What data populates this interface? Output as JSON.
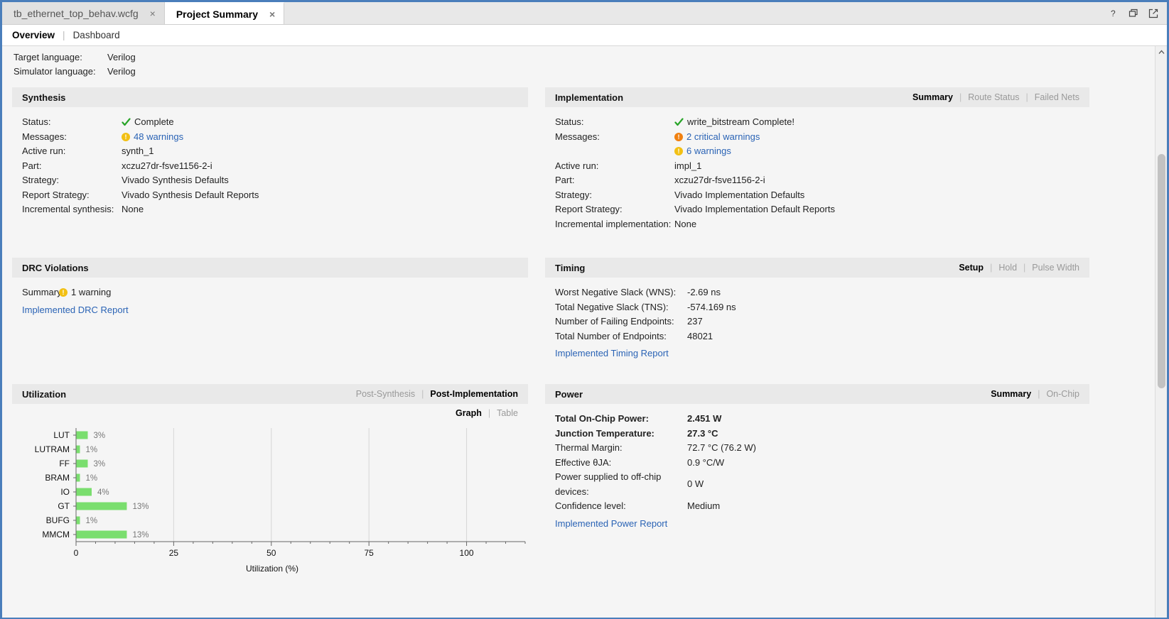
{
  "window": {
    "tabs": [
      {
        "label": "tb_ethernet_top_behav.wcfg",
        "active": false,
        "close": "×"
      },
      {
        "label": "Project Summary",
        "active": true,
        "close": "×"
      }
    ],
    "controls": [
      {
        "name": "help-icon",
        "glyph": "?"
      },
      {
        "name": "restore-icon",
        "glyph": "❐"
      },
      {
        "name": "detach-icon",
        "glyph": "↗"
      }
    ]
  },
  "subnav": {
    "overview": "Overview",
    "separator": "|",
    "dashboard": "Dashboard"
  },
  "top_info": {
    "rows": [
      {
        "key": "Target language:",
        "value": "Verilog",
        "link": true
      },
      {
        "key": "Simulator language:",
        "value": "Verilog",
        "link": true
      }
    ]
  },
  "synthesis": {
    "title": "Synthesis",
    "rows": [
      {
        "key": "Status:",
        "value": "Complete",
        "icon": "check",
        "link": false
      },
      {
        "key": "Messages:",
        "value": "48 warnings",
        "icon": "warn",
        "link": true
      },
      {
        "key": "Active run:",
        "value": "synth_1",
        "link": true
      },
      {
        "key": "Part:",
        "value": "xczu27dr-fsve1156-2-i",
        "link": false
      },
      {
        "key": "Strategy:",
        "value": "Vivado Synthesis Defaults",
        "link": true
      },
      {
        "key": "Report Strategy:",
        "value": "Vivado Synthesis Default Reports",
        "link": true
      },
      {
        "key": "Incremental synthesis:",
        "value": "None",
        "link": true
      }
    ]
  },
  "implementation": {
    "title": "Implementation",
    "head_tabs": [
      {
        "label": "Summary",
        "active": true
      },
      {
        "label": "Route Status",
        "active": false
      },
      {
        "label": "Failed Nets",
        "active": false
      }
    ],
    "rows": [
      {
        "key": "Status:",
        "value": "write_bitstream Complete!",
        "icon": "check",
        "link": false
      },
      {
        "key": "Messages:",
        "value": "2 critical warnings",
        "icon": "warn-crit",
        "link": true
      },
      {
        "key": "",
        "value": "6 warnings",
        "icon": "warn",
        "link": true
      },
      {
        "key": "Active run:",
        "value": "impl_1",
        "link": true
      },
      {
        "key": "Part:",
        "value": "xczu27dr-fsve1156-2-i",
        "link": false
      },
      {
        "key": "Strategy:",
        "value": "Vivado Implementation Defaults",
        "link": true
      },
      {
        "key": "Report Strategy:",
        "value": "Vivado Implementation Default Reports",
        "link": true
      },
      {
        "key": "Incremental implementation:",
        "value": "None",
        "link": true
      }
    ]
  },
  "drc": {
    "title": "DRC Violations",
    "summary_label": "Summary:",
    "summary_value": "1 warning",
    "report_link": "Implemented DRC Report"
  },
  "timing": {
    "title": "Timing",
    "head_tabs": [
      {
        "label": "Setup",
        "active": true
      },
      {
        "label": "Hold",
        "active": false
      },
      {
        "label": "Pulse Width",
        "active": false
      }
    ],
    "rows": [
      {
        "key": "Worst Negative Slack (WNS):",
        "value": "-2.69 ns",
        "red": true
      },
      {
        "key": "Total Negative Slack (TNS):",
        "value": "-574.169 ns",
        "red": true
      },
      {
        "key": "Number of Failing Endpoints:",
        "value": "237",
        "red": false
      },
      {
        "key": "Total Number of Endpoints:",
        "value": "48021",
        "red": false
      }
    ],
    "report_link": "Implemented Timing Report"
  },
  "utilization": {
    "title": "Utilization",
    "head_tabs": [
      {
        "label": "Post-Synthesis",
        "active": false
      },
      {
        "label": "Post-Implementation",
        "active": true
      }
    ],
    "view_tabs": [
      {
        "label": "Graph",
        "active": true
      },
      {
        "label": "Table",
        "active": false
      }
    ]
  },
  "power": {
    "title": "Power",
    "head_tabs": [
      {
        "label": "Summary",
        "active": true
      },
      {
        "label": "On-Chip",
        "active": false
      }
    ],
    "rows": [
      {
        "key": "Total On-Chip Power:",
        "value": "2.451 W",
        "bold": true,
        "link": false
      },
      {
        "key": "Junction Temperature:",
        "value": "27.3 °C",
        "bold": true,
        "link": false
      },
      {
        "key": "Thermal Margin:",
        "value": "72.7 °C (76.2 W)",
        "bold": false,
        "link": false
      },
      {
        "key": "Effective θJA:",
        "value": "0.9 °C/W",
        "bold": false,
        "link": false
      },
      {
        "key": "Power supplied to off-chip devices:",
        "value": "0 W",
        "bold": false,
        "link": false
      },
      {
        "key": "Confidence level:",
        "value": "Medium",
        "bold": false,
        "link": true
      }
    ],
    "report_link": "Implemented Power Report"
  },
  "chart_data": {
    "type": "bar",
    "orientation": "horizontal",
    "title": "",
    "xlabel": "Utilization (%)",
    "ylabel": "",
    "xlim": [
      0,
      115
    ],
    "xticks": [
      0,
      25,
      50,
      75,
      100
    ],
    "grid": true,
    "bar_color": "#7ade6e",
    "categories": [
      "LUT",
      "LUTRAM",
      "FF",
      "BRAM",
      "IO",
      "GT",
      "BUFG",
      "MMCM"
    ],
    "values": [
      3,
      1,
      3,
      1,
      4,
      13,
      1,
      13
    ],
    "labels": [
      "3%",
      "1%",
      "3%",
      "1%",
      "4%",
      "13%",
      "1%",
      "13%"
    ]
  }
}
